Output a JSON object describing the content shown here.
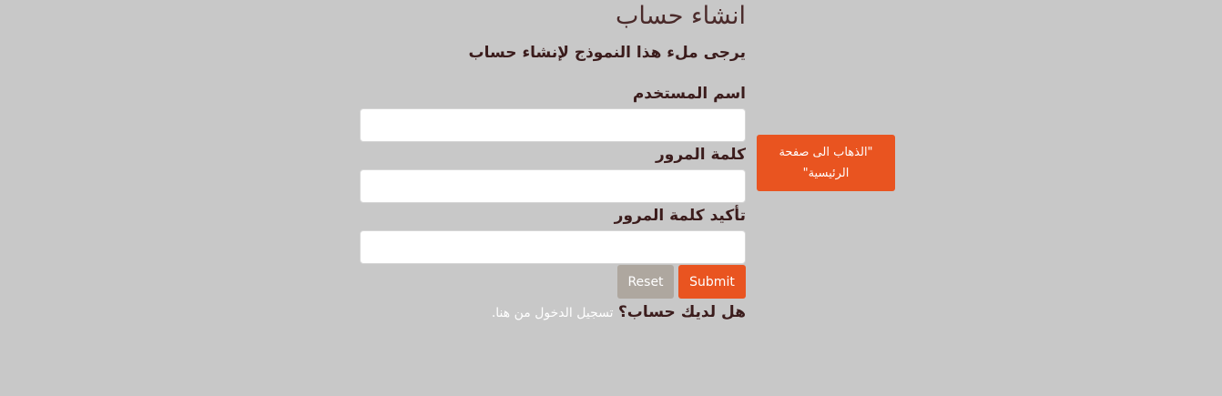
{
  "form": {
    "title": "انشاء حساب",
    "subtitle": "يرجى ملء هذا النموذج لإنشاء حساب",
    "username_label": "اسم المستخدم",
    "username_value": "",
    "password_label": "كلمة المرور",
    "password_value": "",
    "confirm_label": "تأكيد كلمة المرور",
    "confirm_value": "",
    "submit_label": "Submit",
    "reset_label": "Reset",
    "login_question": "هل لديك حساب؟",
    "login_link": "تسجيل الدخول من هنا."
  },
  "nav": {
    "home_button_label": "\"الذهاب الى صفحة الرئيسية\""
  },
  "colors": {
    "background": "#c8c8c8",
    "accent": "#e95420",
    "reset": "#aea79f",
    "text": "#3b1c1c"
  }
}
